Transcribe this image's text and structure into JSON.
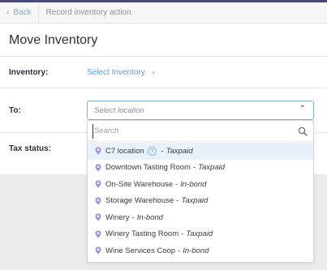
{
  "breadcrumb": {
    "back_label": "Back",
    "current": "Record inventory action"
  },
  "page": {
    "title": "Move Inventory"
  },
  "form": {
    "inventory_label": "Inventory:",
    "inventory_link": "Select Inventory",
    "to_label": "To:",
    "to_placeholder": "Select location",
    "tax_status_label": "Tax status:"
  },
  "dropdown": {
    "search_placeholder": "Search",
    "options": [
      {
        "name": "C7 location",
        "status": "Taxpaid",
        "has_help": true,
        "highlighted": true
      },
      {
        "name": "Downtown Tasting Room",
        "status": "Taxpaid"
      },
      {
        "name": "On-Site Warehouse",
        "status": "In-bond"
      },
      {
        "name": "Storage Warehouse",
        "status": "Taxpaid"
      },
      {
        "name": "Winery",
        "status": "In-bond"
      },
      {
        "name": "Winery Tasting Room",
        "status": "Taxpaid"
      },
      {
        "name": "Wine Services Coop",
        "status": "In-bond"
      }
    ]
  },
  "colors": {
    "accent": "#5b9bd5",
    "pin": "#a98fd8",
    "highlight": "#e9f1fa"
  }
}
